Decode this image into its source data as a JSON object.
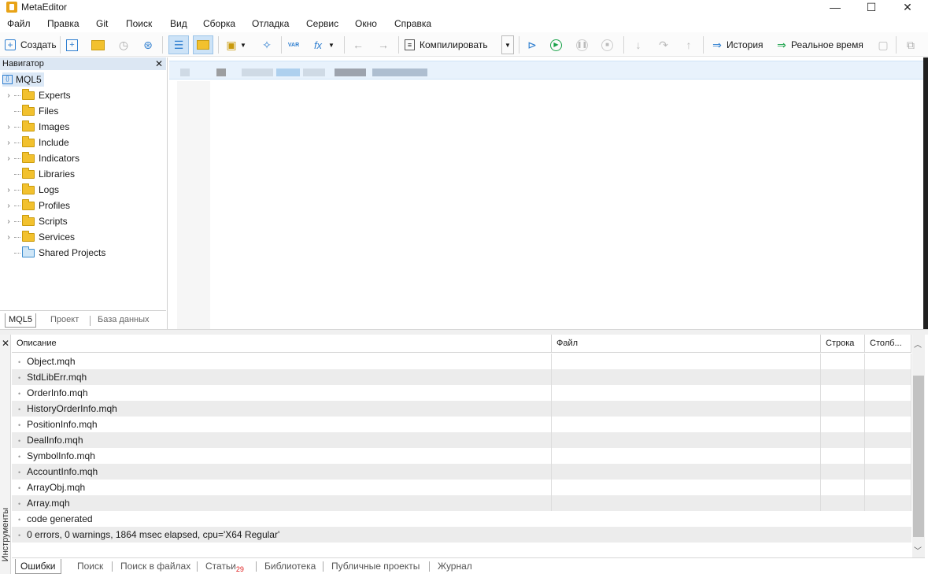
{
  "window": {
    "title": "MetaEditor",
    "minimize": "—",
    "maximize": "☐",
    "close": "✕"
  },
  "menu": [
    "Файл",
    "Правка",
    "Git",
    "Поиск",
    "Вид",
    "Сборка",
    "Отладка",
    "Сервис",
    "Окно",
    "Справка"
  ],
  "toolbar": {
    "create_label": "Создать",
    "compile_label": "Компилировать",
    "history_label": "История",
    "realtime_label": "Реальное время",
    "var_label": "VAR",
    "fx_label": "fx"
  },
  "navigator": {
    "title": "Навигатор",
    "close": "✕",
    "root": "MQL5",
    "items": [
      {
        "label": "Experts",
        "expandable": true
      },
      {
        "label": "Files",
        "expandable": false
      },
      {
        "label": "Images",
        "expandable": true
      },
      {
        "label": "Include",
        "expandable": true
      },
      {
        "label": "Indicators",
        "expandable": true
      },
      {
        "label": "Libraries",
        "expandable": false
      },
      {
        "label": "Logs",
        "expandable": true
      },
      {
        "label": "Profiles",
        "expandable": true
      },
      {
        "label": "Scripts",
        "expandable": true
      },
      {
        "label": "Services",
        "expandable": true
      },
      {
        "label": "Shared Projects",
        "expandable": false
      }
    ],
    "tabs": [
      "MQL5",
      "Проект",
      "База данных"
    ]
  },
  "toolbox": {
    "side_label": "Инструменты",
    "close": "✕",
    "columns": [
      "Описание",
      "Файл",
      "Строка",
      "Столб..."
    ],
    "rows": [
      "Object.mqh",
      "StdLibErr.mqh",
      "OrderInfo.mqh",
      "HistoryOrderInfo.mqh",
      "PositionInfo.mqh",
      "DealInfo.mqh",
      "SymbolInfo.mqh",
      "AccountInfo.mqh",
      "ArrayObj.mqh",
      "Array.mqh",
      "code generated",
      "0 errors, 0 warnings, 1864 msec elapsed, cpu='X64 Regular'"
    ],
    "tabs": [
      "Ошибки",
      "Поиск",
      "Поиск в файлах",
      "Статьи",
      "Библиотека",
      "Публичные проекты",
      "Журнал"
    ],
    "articles_badge": "29"
  }
}
